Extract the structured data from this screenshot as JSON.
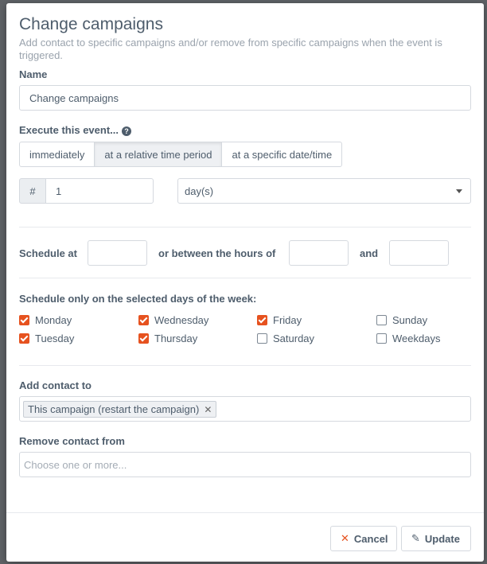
{
  "modal": {
    "title": "Change campaigns",
    "description": "Add contact to specific campaigns and/or remove from specific campaigns when the event is triggered."
  },
  "name_field": {
    "label": "Name",
    "value": "Change campaigns"
  },
  "execute": {
    "label": "Execute this event...",
    "help_icon": "question-circle-icon",
    "options": [
      "immediately",
      "at a relative time period",
      "at a specific date/time"
    ],
    "selected": "at a relative time period"
  },
  "interval": {
    "prefix": "#",
    "value": "1",
    "unit": "day(s)"
  },
  "schedule": {
    "at_label": "Schedule at",
    "between_label": "or between the hours of",
    "and_label": "and",
    "at_value": "",
    "from_value": "",
    "to_value": ""
  },
  "days": {
    "label": "Schedule only on the selected days of the week:",
    "items": [
      {
        "label": "Monday",
        "checked": true
      },
      {
        "label": "Tuesday",
        "checked": true
      },
      {
        "label": "Wednesday",
        "checked": true
      },
      {
        "label": "Thursday",
        "checked": true
      },
      {
        "label": "Friday",
        "checked": true
      },
      {
        "label": "Saturday",
        "checked": false
      },
      {
        "label": "Sunday",
        "checked": false
      },
      {
        "label": "Weekdays",
        "checked": false
      }
    ]
  },
  "add_contact": {
    "label": "Add contact to",
    "tags": [
      "This campaign (restart the campaign)"
    ],
    "remove_icon": "close-icon"
  },
  "remove_contact": {
    "label": "Remove contact from",
    "placeholder": "Choose one or more..."
  },
  "footer": {
    "cancel_label": "Cancel",
    "cancel_icon": "close-icon",
    "update_label": "Update",
    "update_icon": "pencil-icon"
  },
  "colors": {
    "accent": "#e6521f",
    "text": "#4e5d6c",
    "muted": "#9aa3ad"
  }
}
